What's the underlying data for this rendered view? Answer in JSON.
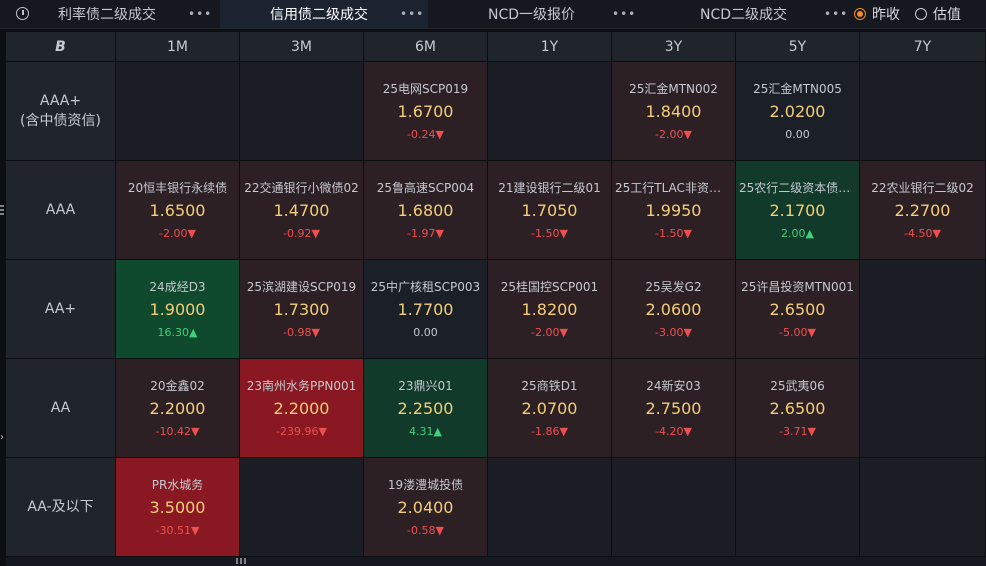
{
  "tabs": [
    {
      "label": "利率债二级成交",
      "active": false
    },
    {
      "label": "信用债二级成交",
      "active": true
    },
    {
      "label": "NCD一级报价",
      "active": false
    },
    {
      "label": "NCD二级成交",
      "active": false
    }
  ],
  "more_label": "•••",
  "radios": [
    {
      "label": "昨收",
      "selected": true
    },
    {
      "label": "估值",
      "selected": false
    }
  ],
  "corner_icon": "B",
  "columns": [
    "1M",
    "3M",
    "6M",
    "1Y",
    "3Y",
    "5Y",
    "7Y"
  ],
  "rows": [
    {
      "label": "AAA+",
      "sublabel": "(含中债资信)",
      "cells": [
        null,
        null,
        {
          "name": "25电网SCP019",
          "yield": "1.6700",
          "change": "-0.24▼",
          "dir": "dn",
          "bg": "red"
        },
        null,
        {
          "name": "25汇金MTN002",
          "yield": "1.8400",
          "change": "-2.00▼",
          "dir": "dn",
          "bg": "red"
        },
        {
          "name": "25汇金MTN005",
          "yield": "2.0200",
          "change": "0.00",
          "dir": "flat",
          "bg": "navy"
        },
        null
      ]
    },
    {
      "label": "AAA",
      "sublabel": "",
      "cells": [
        {
          "name": "20恒丰银行永续债",
          "yield": "1.6500",
          "change": "-2.00▼",
          "dir": "dn",
          "bg": "red"
        },
        {
          "name": "22交通银行小微债02",
          "yield": "1.4700",
          "change": "-0.92▼",
          "dir": "dn",
          "bg": "red"
        },
        {
          "name": "25鲁高速SCP004",
          "yield": "1.6800",
          "change": "-1.97▼",
          "dir": "dn",
          "bg": "red"
        },
        {
          "name": "21建设银行二级01",
          "yield": "1.7050",
          "change": "-1.50▼",
          "dir": "dn",
          "bg": "red"
        },
        {
          "name": "25工行TLAC非资本...",
          "yield": "1.9950",
          "change": "-1.50▼",
          "dir": "dn",
          "bg": "red"
        },
        {
          "name": "25农行二级资本债0...",
          "yield": "2.1700",
          "change": "2.00▲",
          "dir": "up",
          "bg": "green"
        },
        {
          "name": "22农业银行二级02",
          "yield": "2.2700",
          "change": "-4.50▼",
          "dir": "dn",
          "bg": "red"
        }
      ]
    },
    {
      "label": "AA+",
      "sublabel": "",
      "cells": [
        {
          "name": "24成经D3",
          "yield": "1.9000",
          "change": "16.30▲",
          "dir": "up",
          "bg": "dkgreen"
        },
        {
          "name": "25滨湖建设SCP019",
          "yield": "1.7300",
          "change": "-0.98▼",
          "dir": "dn",
          "bg": "red"
        },
        {
          "name": "25中广核租SCP003",
          "yield": "1.7700",
          "change": "0.00",
          "dir": "flat",
          "bg": "navy"
        },
        {
          "name": "25桂国控SCP001",
          "yield": "1.8200",
          "change": "-2.00▼",
          "dir": "dn",
          "bg": "red"
        },
        {
          "name": "25吴发G2",
          "yield": "2.0600",
          "change": "-3.00▼",
          "dir": "dn",
          "bg": "red"
        },
        {
          "name": "25许昌投资MTN001",
          "yield": "2.6500",
          "change": "-5.00▼",
          "dir": "dn",
          "bg": "red"
        },
        null
      ]
    },
    {
      "label": "AA",
      "sublabel": "",
      "cells": [
        {
          "name": "20金鑫02",
          "yield": "2.2000",
          "change": "-10.42▼",
          "dir": "dn",
          "bg": "red"
        },
        {
          "name": "23南州水务PPN001",
          "yield": "2.2000",
          "change": "-239.96▼",
          "dir": "dn",
          "bg": "deepred"
        },
        {
          "name": "23鼎兴01",
          "yield": "2.2500",
          "change": "4.31▲",
          "dir": "up",
          "bg": "green"
        },
        {
          "name": "25商铁D1",
          "yield": "2.0700",
          "change": "-1.86▼",
          "dir": "dn",
          "bg": "red"
        },
        {
          "name": "24新安03",
          "yield": "2.7500",
          "change": "-4.20▼",
          "dir": "dn",
          "bg": "red"
        },
        {
          "name": "25武夷06",
          "yield": "2.6500",
          "change": "-3.71▼",
          "dir": "dn",
          "bg": "red"
        },
        null
      ]
    },
    {
      "label": "AA-及以下",
      "sublabel": "",
      "cells": [
        {
          "name": "PR水城务",
          "yield": "3.5000",
          "change": "-30.51▼",
          "dir": "dn",
          "bg": "deepred"
        },
        null,
        {
          "name": "19溇澧城投债",
          "yield": "2.0400",
          "change": "-0.58▼",
          "dir": "dn",
          "bg": "red"
        },
        null,
        null,
        null,
        null
      ]
    }
  ]
}
